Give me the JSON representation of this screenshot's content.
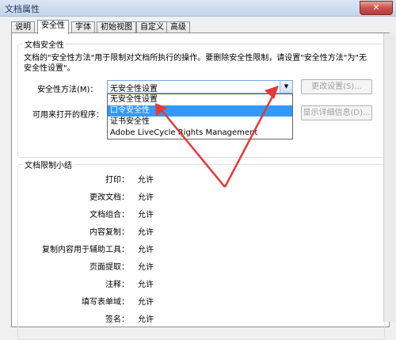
{
  "window": {
    "title": "文档属性",
    "close_label": "✕"
  },
  "tabs": [
    {
      "label": "说明"
    },
    {
      "label": "安全性"
    },
    {
      "label": "字体"
    },
    {
      "label": "初始视图"
    },
    {
      "label": "自定义"
    },
    {
      "label": "高级"
    }
  ],
  "security_group": {
    "title": "文档安全性",
    "description_line1": "文档的\"安全性方法\"用于限制对文档所执行的操作。要删除安全性限制，请设置\"安全性方法\"为\"无",
    "description_line2": "安全性设置\"。",
    "method_label": "安全性方法(M)：",
    "method_value": "无安全性设置",
    "change_button": "更改设置(S)...",
    "open_label": "可用来打开的程序：",
    "details_button": "显示详细信息(D)...",
    "options": [
      {
        "label": "无安全性设置"
      },
      {
        "label": "口令安全性"
      },
      {
        "label": "证书安全性"
      },
      {
        "label": "Adobe LiveCycle Rights Management"
      }
    ]
  },
  "summary_group": {
    "title": "文档限制小结",
    "rows": [
      {
        "label": "打印：",
        "value": "允许"
      },
      {
        "label": "更改文档：",
        "value": "允许"
      },
      {
        "label": "文档组合：",
        "value": "允许"
      },
      {
        "label": "内容复制：",
        "value": "允许"
      },
      {
        "label": "复制内容用于辅助工具：",
        "value": "允许"
      },
      {
        "label": "页面提取：",
        "value": "允许"
      },
      {
        "label": "注释：",
        "value": "允许"
      },
      {
        "label": "填写表单域：",
        "value": "允许"
      },
      {
        "label": "签名：",
        "value": "允许"
      }
    ]
  },
  "colors": {
    "selection": "#3399ff",
    "annotation_arrow": "#e53935"
  }
}
